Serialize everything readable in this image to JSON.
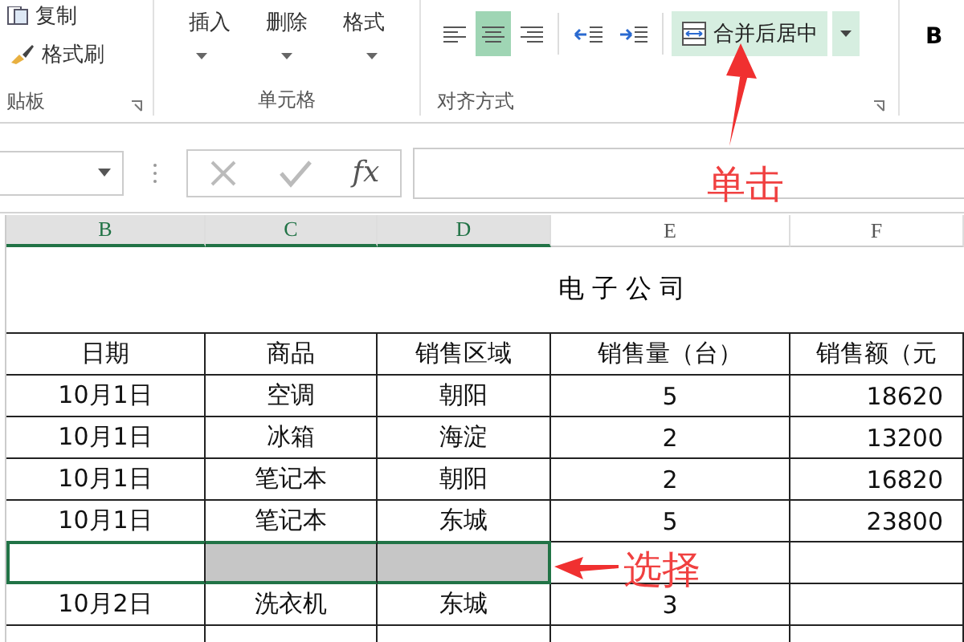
{
  "ribbon": {
    "clipboard": {
      "items": [
        {
          "kind": "copy",
          "label": "复制"
        },
        {
          "kind": "brush",
          "label": "格式刷"
        }
      ],
      "group_label": "贴板"
    },
    "cells": {
      "buttons": [
        "插入",
        "删除",
        "格式"
      ],
      "group_label": "单元格"
    },
    "alignment": {
      "align_buttons": [
        {
          "kind": "left",
          "selected": false
        },
        {
          "kind": "center",
          "selected": true
        },
        {
          "kind": "right",
          "selected": false
        }
      ],
      "indent_buttons": [
        {
          "kind": "decrease"
        },
        {
          "kind": "increase"
        }
      ],
      "merge_button": {
        "label": "合并后居中",
        "selected": true
      },
      "group_label": "对齐方式"
    },
    "font": {
      "bold_label": "B"
    }
  },
  "formula_bar": {
    "function_label": "fx"
  },
  "sheet": {
    "columns": [
      {
        "label": "B",
        "selected": true
      },
      {
        "label": "C",
        "selected": true
      },
      {
        "label": "D",
        "selected": true
      },
      {
        "label": "E",
        "selected": false
      },
      {
        "label": "F",
        "selected": false
      }
    ],
    "title": "电 子 公 司",
    "headers": [
      "日期",
      "商品",
      "销售区域",
      "销售量（台）",
      "销售额（元"
    ],
    "rows": [
      {
        "cells": [
          "10月1日",
          "空调",
          "朝阳",
          "5",
          "18620"
        ],
        "selected": false
      },
      {
        "cells": [
          "10月1日",
          "冰箱",
          "海淀",
          "2",
          "13200"
        ],
        "selected": false
      },
      {
        "cells": [
          "10月1日",
          "笔记本",
          "朝阳",
          "2",
          "16820"
        ],
        "selected": false
      },
      {
        "cells": [
          "10月1日",
          "笔记本",
          "东城",
          "5",
          "23800"
        ],
        "selected": false
      },
      {
        "cells": [
          "",
          "",
          "",
          "",
          ""
        ],
        "selected": true
      },
      {
        "cells": [
          "10月2日",
          "洗衣机",
          "东城",
          "3",
          ""
        ],
        "selected": false
      }
    ]
  },
  "annotations": [
    {
      "kind": "click",
      "text": "单击"
    },
    {
      "kind": "select",
      "text": "选择"
    }
  ]
}
